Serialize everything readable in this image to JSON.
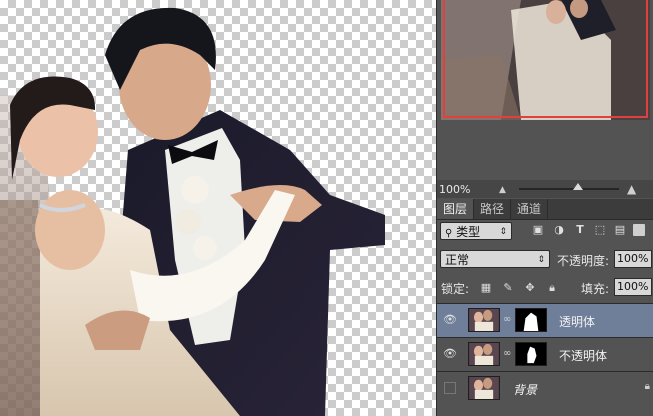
{
  "navigator": {
    "zoom": "100%"
  },
  "tabs": [
    {
      "label": "图层",
      "active": true
    },
    {
      "label": "路径",
      "active": false
    },
    {
      "label": "通道",
      "active": false
    }
  ],
  "filter": {
    "kind": "类型"
  },
  "blend": {
    "mode": "正常",
    "opacity_label": "不透明度:",
    "opacity_value": "100%"
  },
  "lock": {
    "label": "锁定:",
    "fill_label": "填充:",
    "fill_value": "100%"
  },
  "layers": [
    {
      "name": "透明体",
      "selected": true,
      "visible": true,
      "has_mask": true
    },
    {
      "name": "不透明体",
      "selected": false,
      "visible": true,
      "has_mask": true
    },
    {
      "name": "背景",
      "selected": false,
      "visible": false,
      "locked": true
    }
  ],
  "icons": {
    "eye": "eye-icon",
    "link": "chain-link-icon",
    "lock": "lock-icon",
    "search": "search-icon",
    "image": "image-filter-icon",
    "adjust": "adjustment-filter-icon",
    "text": "text-filter-icon",
    "shape": "shape-filter-icon",
    "smart": "smart-object-filter-icon"
  },
  "colors": {
    "selected_layer": "#6f7f99",
    "panel_bg": "#535353",
    "nav_frame": "#e04040"
  }
}
